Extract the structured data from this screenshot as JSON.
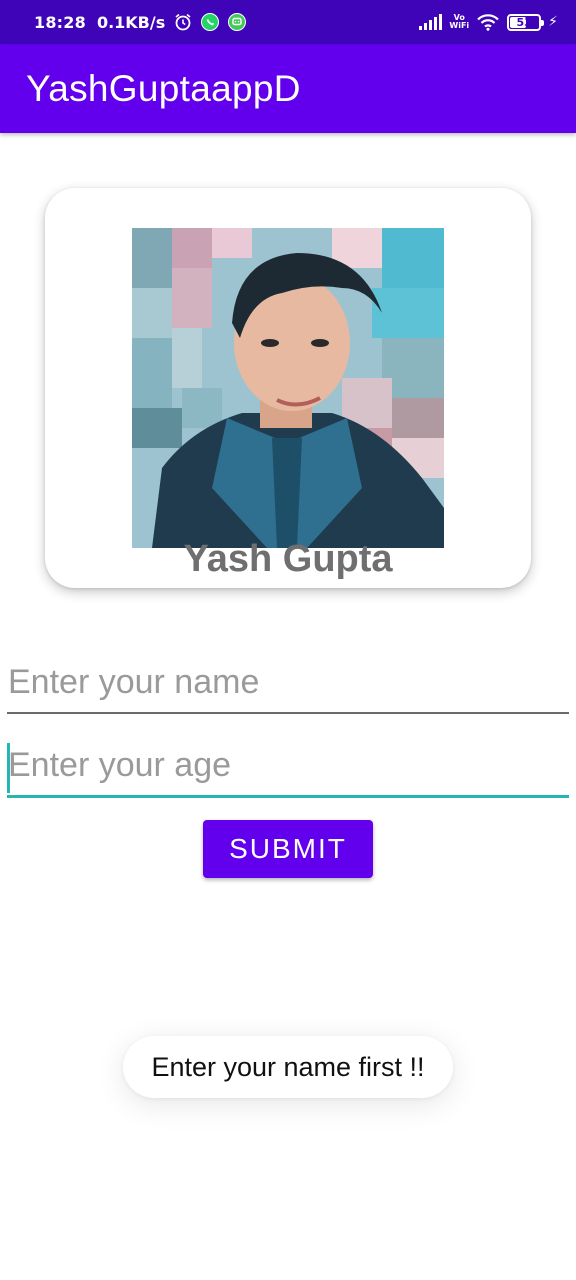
{
  "status_bar": {
    "time": "18:28",
    "speed": "0.1KB/s",
    "icons": [
      "alarm-icon",
      "whatsapp-icon",
      "message-icon",
      "signal-icon",
      "vowifi-icon",
      "wifi-icon",
      "battery-icon",
      "charging-icon"
    ],
    "vowifi_top": "Vo",
    "vowifi_bottom": "WiFi",
    "battery_level": "53",
    "background": "#3f04b8"
  },
  "app_bar": {
    "title": "YashGuptaappD",
    "color": "#6200ee"
  },
  "profile": {
    "name": "Yash Gupta"
  },
  "form": {
    "name_placeholder": "Enter your name",
    "age_placeholder": "Enter your age",
    "submit_label": "SUBMIT",
    "focus_color": "#26b5b5"
  },
  "toast": {
    "message": "Enter your name first !!"
  }
}
